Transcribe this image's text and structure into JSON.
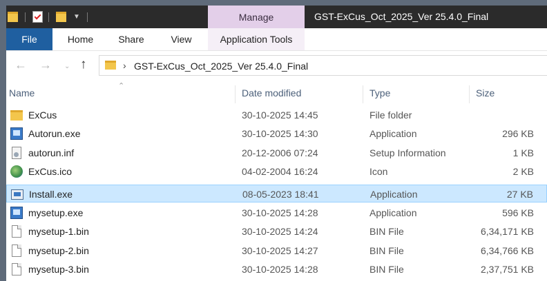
{
  "window": {
    "title": "GST-ExCus_Oct_2025_Ver 25.4.0_Final",
    "context_tab": "Manage"
  },
  "ribbon": {
    "tabs": [
      "File",
      "Home",
      "Share",
      "View",
      "Application Tools"
    ]
  },
  "address": {
    "path": "GST-ExCus_Oct_2025_Ver 25.4.0_Final"
  },
  "columns": {
    "name": "Name",
    "date": "Date modified",
    "type": "Type",
    "size": "Size"
  },
  "files": [
    {
      "name": "ExCus",
      "date": "30-10-2025 14:45",
      "type": "File folder",
      "size": "",
      "icon": "folder-icon"
    },
    {
      "name": "Autorun.exe",
      "date": "30-10-2025 14:30",
      "type": "Application",
      "size": "296 KB",
      "icon": "setup-exe-icon"
    },
    {
      "name": "autorun.inf",
      "date": "20-12-2006 07:24",
      "type": "Setup Information",
      "size": "1 KB",
      "icon": "inf-file-icon"
    },
    {
      "name": "ExCus.ico",
      "date": "04-02-2004 16:24",
      "type": "Icon",
      "size": "2 KB",
      "icon": "globe-icon"
    },
    {
      "name": "Install.exe",
      "date": "08-05-2023 18:41",
      "type": "Application",
      "size": "27 KB",
      "icon": "installer-icon",
      "selected": true
    },
    {
      "name": "mysetup.exe",
      "date": "30-10-2025 14:28",
      "type": "Application",
      "size": "596 KB",
      "icon": "setup-exe-icon"
    },
    {
      "name": "mysetup-1.bin",
      "date": "30-10-2025 14:24",
      "type": "BIN File",
      "size": "6,34,171 KB",
      "icon": "blank-file-icon"
    },
    {
      "name": "mysetup-2.bin",
      "date": "30-10-2025 14:27",
      "type": "BIN File",
      "size": "6,34,766 KB",
      "icon": "blank-file-icon"
    },
    {
      "name": "mysetup-3.bin",
      "date": "30-10-2025 14:28",
      "type": "BIN File",
      "size": "2,37,751 KB",
      "icon": "blank-file-icon"
    }
  ],
  "colors": {
    "titlebar": "#2b2b2b",
    "manage_tab": "#e3cfe9",
    "file_tab": "#1f5fa0",
    "selection": "#cce8ff",
    "folder": "#f3c64c"
  }
}
